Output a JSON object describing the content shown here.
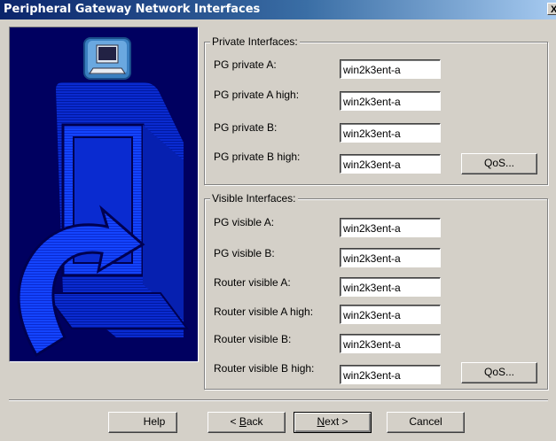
{
  "window": {
    "title": "Peripheral Gateway Network Interfaces",
    "close_glyph": "X"
  },
  "private_group": {
    "legend": "Private Interfaces:",
    "rows": [
      {
        "label": "PG private A:",
        "value": "win2k3ent-a"
      },
      {
        "label": "PG private A high:",
        "value": "win2k3ent-a"
      },
      {
        "label": "PG private B:",
        "value": "win2k3ent-a"
      },
      {
        "label": "PG private B high:",
        "value": "win2k3ent-a"
      }
    ],
    "qos_label": "QoS..."
  },
  "visible_group": {
    "legend": "Visible Interfaces:",
    "rows": [
      {
        "label": "PG visible A:",
        "value": "win2k3ent-a"
      },
      {
        "label": "PG visible B:",
        "value": "win2k3ent-a"
      },
      {
        "label": "Router visible A:",
        "value": "win2k3ent-a"
      },
      {
        "label": "Router visible A high:",
        "value": "win2k3ent-a"
      },
      {
        "label": "Router visible B:",
        "value": "win2k3ent-a"
      },
      {
        "label": "Router visible B high:",
        "value": "win2k3ent-a"
      }
    ],
    "qos_label": "QoS..."
  },
  "buttons": {
    "help": "Help",
    "back_prefix": "< ",
    "back_mnemonic": "B",
    "back_rest": "ack",
    "next_mnemonic": "N",
    "next_rest": "ext >",
    "cancel": "Cancel"
  }
}
